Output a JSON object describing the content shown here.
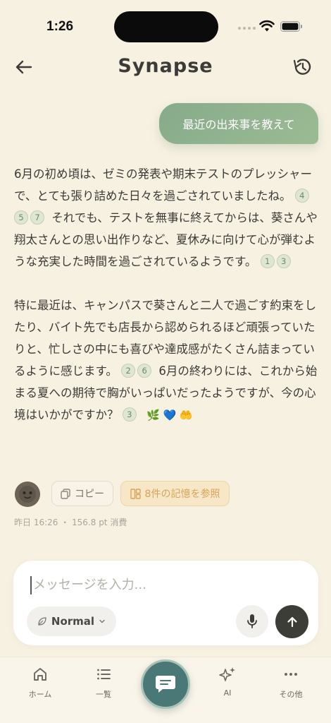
{
  "status_bar": {
    "time": "1:26"
  },
  "header": {
    "title": "Synapse"
  },
  "user_message": {
    "text": "最近の出来事を教えて"
  },
  "assistant_message": {
    "p1_a": "6月の初め頃は、ゼミの発表や期末テストのプレッシャーで、とても張り詰めた日々を過ごされていましたね。",
    "p1_cite_a": [
      "4",
      "5",
      "7"
    ],
    "p1_b": " それでも、テストを無事に終えてからは、葵さんや翔太さんとの思い出作りなど、夏休みに向けて心が弾むような充実した時間を過ごされているようです。",
    "p1_cite_b": [
      "1",
      "3"
    ],
    "p2_a": "特に最近は、キャンパスで葵さんと二人で過ごす約束をしたり、バイト先でも店長から認められるほど頑張っていたりと、忙しさの中にも喜びや達成感がたくさん詰まっているように感じます。",
    "p2_cite_a": [
      "2",
      "6"
    ],
    "p2_b": " 6月の終わりには、これから始まる夏への期待で胸がいっぱいだったようですが、今の心境はいかがですか？",
    "p2_cite_b": [
      "3"
    ],
    "emojis": "🌿 💙 🤲"
  },
  "actions": {
    "copy_label": "コピー",
    "memory_label": "8件の記憶を参照"
  },
  "meta": {
    "text": "昨日 16:26 ・ 156.8 pt 消費"
  },
  "composer": {
    "placeholder": "メッセージを入力...",
    "mode_label": "Normal"
  },
  "nav": {
    "home": "ホーム",
    "list": "一覧",
    "ai": "AI",
    "more": "その他"
  },
  "colors": {
    "background": "#f7f1e2",
    "user_bubble": "#8fb08d",
    "citation_bg": "#dfe6d3",
    "memory_accent": "#d6a45b",
    "send_button": "#3d3d38",
    "chat_fab": "#4a7876"
  }
}
